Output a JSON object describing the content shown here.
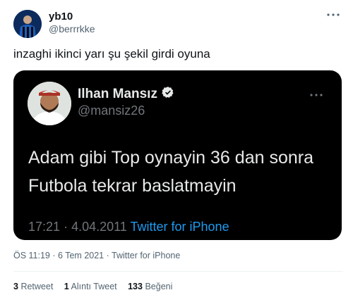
{
  "author": {
    "name": "yb10",
    "handle": "@berrrkke"
  },
  "tweet": {
    "text": "inzaghi ikinci yarı şu şekil girdi oyuna",
    "time": "ÖS 11:19",
    "date": "6 Tem 2021",
    "source": "Twitter for iPhone",
    "separator": "·"
  },
  "quoted": {
    "name": "Ilhan Mansız",
    "handle": "@mansiz26",
    "line1": "Adam gibi Top oynayin 36 dan sonra",
    "line2": "Futbola tekrar baslatmayin",
    "time": "17:21",
    "separator": "·",
    "date": "4.04.2011",
    "source": "Twitter for iPhone"
  },
  "stats": {
    "retweets_count": "3",
    "retweets_label": "Retweet",
    "quotes_count": "1",
    "quotes_label": "Alıntı Tweet",
    "likes_count": "133",
    "likes_label": "Beğeni"
  },
  "colors": {
    "link": "#1d9bf0",
    "verified": "#e7e9ea",
    "card_bg": "#000000"
  },
  "icons": [
    "more-icon",
    "verified-icon",
    "avatar"
  ]
}
